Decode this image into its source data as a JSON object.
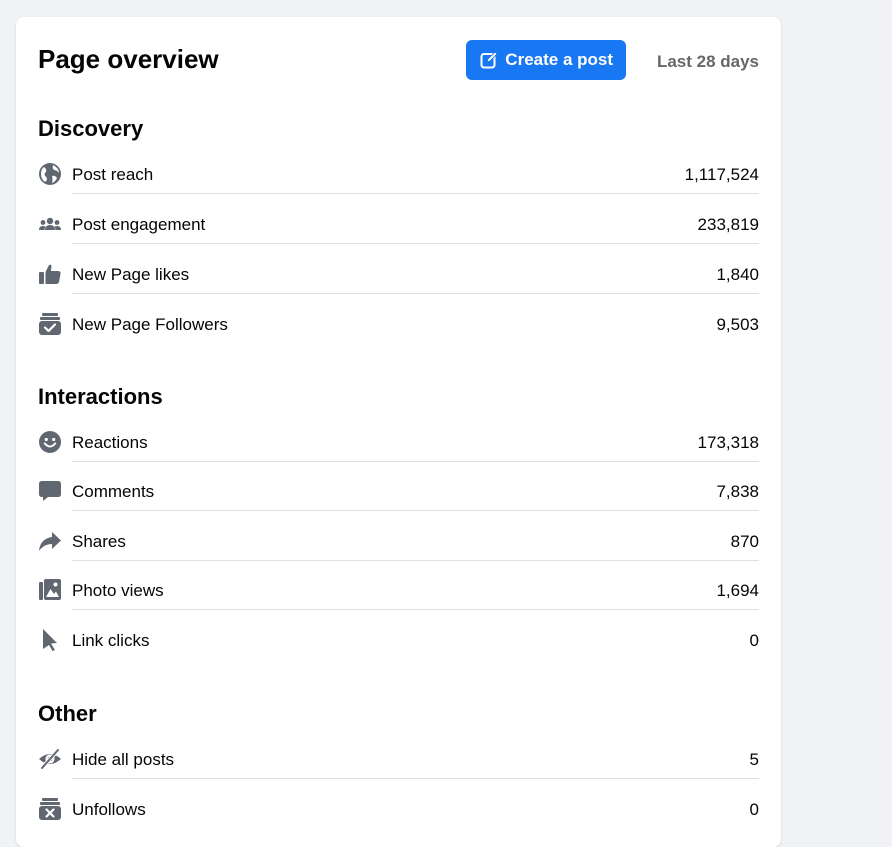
{
  "header": {
    "title": "Page overview",
    "create_post_label": "Create a post",
    "date_range": "Last 28 days"
  },
  "colors": {
    "primary": "#1877f2",
    "icon": "#606770",
    "text": "#050505",
    "muted": "#65676b",
    "background": "#f0f2f5"
  },
  "sections": {
    "discovery": {
      "title": "Discovery",
      "rows": [
        {
          "label": "Post reach",
          "value": "1,117,524",
          "icon": "globe-icon"
        },
        {
          "label": "Post engagement",
          "value": "233,819",
          "icon": "people-icon"
        },
        {
          "label": "New Page likes",
          "value": "1,840",
          "icon": "thumbs-up-icon"
        },
        {
          "label": "New Page Followers",
          "value": "9,503",
          "icon": "follow-box-icon"
        }
      ]
    },
    "interactions": {
      "title": "Interactions",
      "rows": [
        {
          "label": "Reactions",
          "value": "173,318",
          "icon": "smiley-icon"
        },
        {
          "label": "Comments",
          "value": "7,838",
          "icon": "comment-icon"
        },
        {
          "label": "Shares",
          "value": "870",
          "icon": "share-arrow-icon"
        },
        {
          "label": "Photo views",
          "value": "1,694",
          "icon": "photo-icon"
        },
        {
          "label": "Link clicks",
          "value": "0",
          "icon": "cursor-icon"
        }
      ]
    },
    "other": {
      "title": "Other",
      "rows": [
        {
          "label": "Hide all posts",
          "value": "5",
          "icon": "eye-slash-icon"
        },
        {
          "label": "Unfollows",
          "value": "0",
          "icon": "unfollow-box-icon"
        }
      ]
    }
  }
}
